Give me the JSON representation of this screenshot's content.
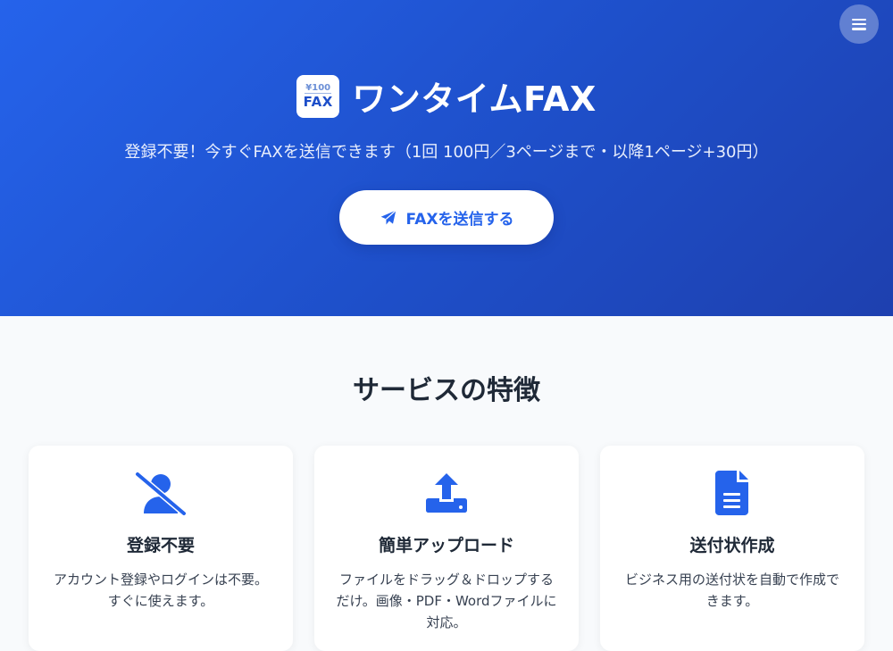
{
  "header": {
    "logo_yen": "¥100",
    "logo_fax": "FAX",
    "title": "ワンタイムFAX",
    "tagline": "登録不要！今すぐFAXを送信できます（1回 100円／3ページまで・以降1ページ+30円）",
    "cta_label": "FAXを送信する",
    "menu_icon": "hamburger-icon",
    "cta_icon": "paper-plane-icon"
  },
  "features": {
    "title": "サービスの特徴",
    "cards": [
      {
        "icon": "user-slash-icon",
        "title": "登録不要",
        "desc": "アカウント登録やログインは不要。すぐに使えます。"
      },
      {
        "icon": "upload-icon",
        "title": "簡単アップロード",
        "desc": "ファイルをドラッグ＆ドロップするだけ。画像・PDF・Wordファイルに対応。"
      },
      {
        "icon": "document-icon",
        "title": "送付状作成",
        "desc": "ビジネス用の送付状を自動で作成できます。"
      }
    ]
  },
  "colors": {
    "primary": "#2563eb",
    "hero_gradient_start": "#2563eb",
    "hero_gradient_end": "#1e40af",
    "text_dark": "#1f2937"
  }
}
